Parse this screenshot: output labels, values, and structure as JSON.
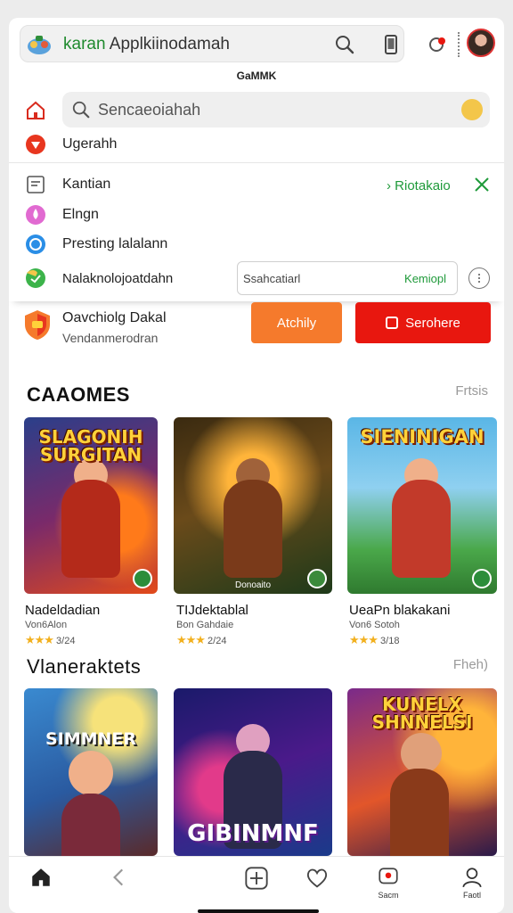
{
  "header": {
    "brand": "karan",
    "title": "Applkiinodamah",
    "caption": "GaMMK"
  },
  "menu": {
    "search_placeholder": "Sencaeoiahah",
    "items": [
      {
        "label": "Ugerahh"
      },
      {
        "label": "Kantian"
      },
      {
        "label": "Elngn"
      },
      {
        "label": "Presting lalalann"
      },
      {
        "label": "Nalaknolojoatdahn"
      }
    ],
    "link_label": "Riotakaio",
    "input_placeholder": "Ssahcatiarl",
    "input_action": "Kemiopl",
    "promo_title": "Oavchiolg Dakal",
    "promo_subtitle": "Vendanmerodran",
    "orange_button": "Atchily",
    "red_button": "Serohere"
  },
  "section1": {
    "title": "CAAOMES",
    "link": "Frtsis",
    "games": [
      {
        "cover_title": "SLAGONIH SURGITAN",
        "name": "Nadeldadian",
        "dev": "Von6Alon",
        "stars": "★★★",
        "rating": "3/24"
      },
      {
        "cover_title": "",
        "cover_caption": "Donoaito",
        "name": "TIJdektablal",
        "dev": "Bon Gahdaie",
        "stars": "★★★",
        "rating": "2/24"
      },
      {
        "cover_title": "SIENINIGAN",
        "name": "UeaPn blakakani",
        "dev": "Von6 Sotoh",
        "stars": "★★★",
        "rating": "3/18"
      }
    ]
  },
  "section2": {
    "title": "Vlaneraktets",
    "link": "Fheh)",
    "games": [
      {
        "cover_title": "SIMMNER"
      },
      {
        "cover_title": "GIBINMNF"
      },
      {
        "cover_title": "KUNELX SHNNELSI"
      }
    ]
  },
  "bottom_nav": {
    "items": [
      {
        "label": "",
        "icon": "home-icon"
      },
      {
        "label": "",
        "icon": "back-icon"
      },
      {
        "label": "",
        "icon": "add-icon"
      },
      {
        "label": "",
        "icon": "heart-icon"
      },
      {
        "label": "Sacm",
        "icon": "chat-icon"
      },
      {
        "label": "Faotl",
        "icon": "profile-icon"
      }
    ]
  },
  "colors": {
    "brand_green": "#1f8a2e",
    "orange": "#f57a2c",
    "red": "#e8170f",
    "star": "#f2b01e"
  }
}
